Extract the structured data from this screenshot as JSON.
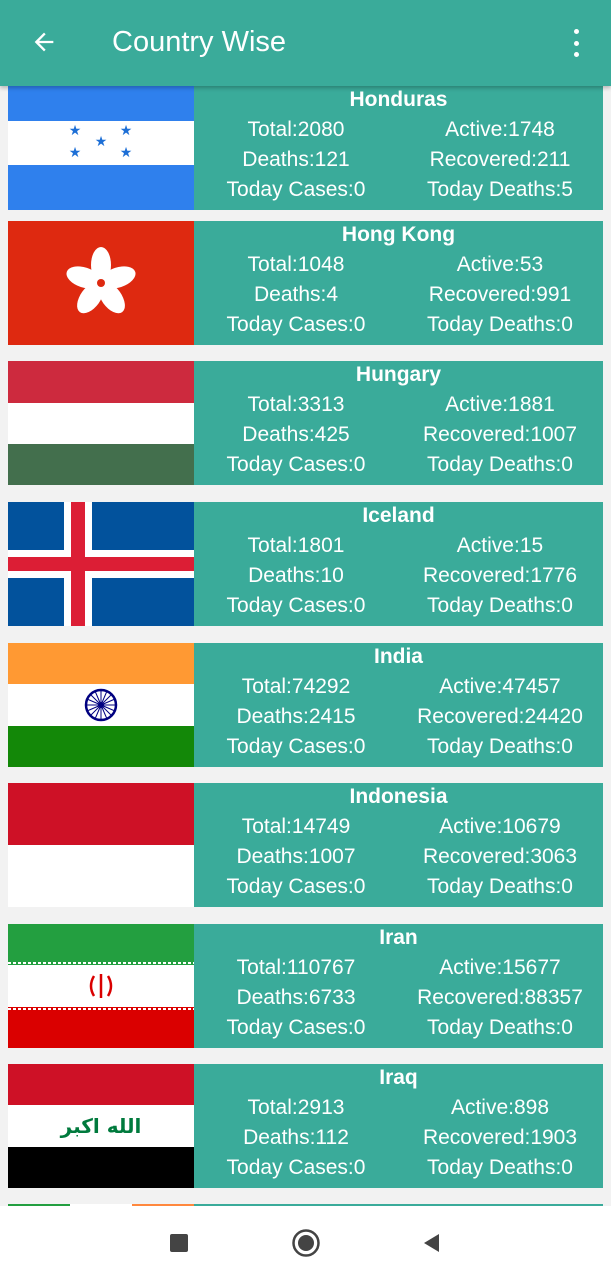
{
  "appbar": {
    "title": "Country Wise"
  },
  "countries": [
    {
      "name": "Honduras",
      "total": "Total:2080",
      "active": "Active:1748",
      "deaths": "Deaths:121",
      "recovered": "Recovered:211",
      "today_cases": "Today Cases:0",
      "today_deaths": "Today Deaths:5"
    },
    {
      "name": "Hong Kong",
      "total": "Total:1048",
      "active": "Active:53",
      "deaths": "Deaths:4",
      "recovered": "Recovered:991",
      "today_cases": "Today Cases:0",
      "today_deaths": "Today Deaths:0"
    },
    {
      "name": "Hungary",
      "total": "Total:3313",
      "active": "Active:1881",
      "deaths": "Deaths:425",
      "recovered": "Recovered:1007",
      "today_cases": "Today Cases:0",
      "today_deaths": "Today Deaths:0"
    },
    {
      "name": "Iceland",
      "total": "Total:1801",
      "active": "Active:15",
      "deaths": "Deaths:10",
      "recovered": "Recovered:1776",
      "today_cases": "Today Cases:0",
      "today_deaths": "Today Deaths:0"
    },
    {
      "name": "India",
      "total": "Total:74292",
      "active": "Active:47457",
      "deaths": "Deaths:2415",
      "recovered": "Recovered:24420",
      "today_cases": "Today Cases:0",
      "today_deaths": "Today Deaths:0"
    },
    {
      "name": "Indonesia",
      "total": "Total:14749",
      "active": "Active:10679",
      "deaths": "Deaths:1007",
      "recovered": "Recovered:3063",
      "today_cases": "Today Cases:0",
      "today_deaths": "Today Deaths:0"
    },
    {
      "name": "Iran",
      "total": "Total:110767",
      "active": "Active:15677",
      "deaths": "Deaths:6733",
      "recovered": "Recovered:88357",
      "today_cases": "Today Cases:0",
      "today_deaths": "Today Deaths:0"
    },
    {
      "name": "Iraq",
      "total": "Total:2913",
      "active": "Active:898",
      "deaths": "Deaths:112",
      "recovered": "Recovered:1903",
      "today_cases": "Today Cases:0",
      "today_deaths": "Today Deaths:0",
      "flag_text": "الله اكبر"
    }
  ],
  "icons": {
    "back": "arrow-back-icon",
    "more": "more-vert-icon",
    "nav_recents": "square-icon",
    "nav_home": "circle-icon",
    "nav_back": "triangle-icon"
  },
  "colors": {
    "accent": "#3aab9a"
  }
}
